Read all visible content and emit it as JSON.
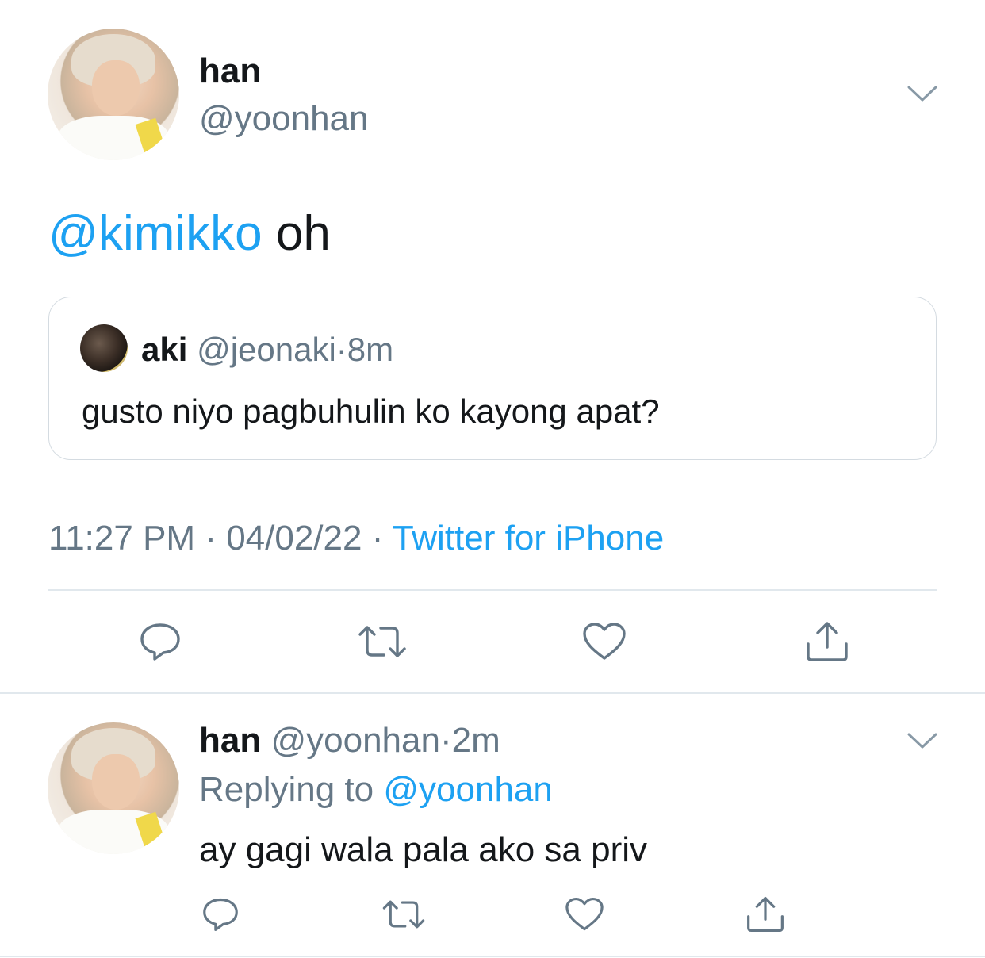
{
  "main_tweet": {
    "author": {
      "name": "han",
      "handle": "@yoonhan"
    },
    "text": {
      "mention": "@kimikko",
      "body": " oh"
    },
    "quoted_tweet": {
      "name": "aki",
      "handle": "@jeonaki",
      "separator": "·",
      "time": "8m",
      "text": "gusto niyo pagbuhulin ko kayong apat?"
    },
    "meta": {
      "time": "11:27 PM",
      "separator": "·",
      "date": "04/02/22",
      "separator2": "·",
      "source": "Twitter for iPhone"
    }
  },
  "reply_tweet": {
    "name": "han",
    "handle": "@yoonhan",
    "separator": "·",
    "time": "2m",
    "replying_prefix": "Replying to ",
    "replying_to": "@yoonhan",
    "text": "ay gagi wala pala ako sa priv"
  },
  "icons": {
    "reply": "reply-bubble-icon",
    "retweet": "retweet-icon",
    "like": "heart-icon",
    "share": "share-icon",
    "more": "chevron-down-icon"
  },
  "colors": {
    "link": "#1da1f2",
    "text": "#14171a",
    "secondary": "#657786",
    "border": "#e1e8ed"
  }
}
